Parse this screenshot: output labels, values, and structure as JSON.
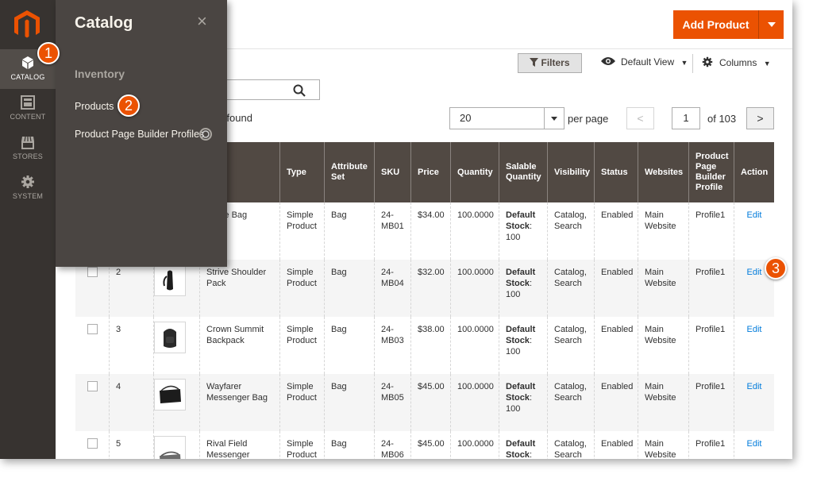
{
  "nav": {
    "items": [
      {
        "label": "CATALOG",
        "icon": "cube-icon"
      },
      {
        "label": "CONTENT",
        "icon": "layout-icon"
      },
      {
        "label": "STORES",
        "icon": "store-icon"
      },
      {
        "label": "SYSTEM",
        "icon": "gear-icon"
      }
    ]
  },
  "flyout": {
    "title": "Catalog",
    "close": "×",
    "section": "Inventory",
    "links": [
      "Products",
      "Product Page Builder Profiles"
    ]
  },
  "callouts": [
    "1",
    "2",
    "3"
  ],
  "header": {
    "add_product": "Add Product"
  },
  "toolbar": {
    "filters": "Filters",
    "default_view": "Default View",
    "columns": "Columns",
    "records_found": "cords found",
    "per_page_value": "20",
    "per_page_label": "per page",
    "page": "1",
    "of_pages": "of 103",
    "prev": "<",
    "next": ">"
  },
  "table": {
    "headers": [
      "",
      "",
      "",
      "e",
      "Type",
      "Attribute Set",
      "SKU",
      "Price",
      "Quantity",
      "Salable Quantity",
      "Visibility",
      "Status",
      "Websites",
      "Product Page Builder Profile",
      "Action"
    ],
    "rows": [
      {
        "id": "",
        "name": "Duffle Bag",
        "type": "Simple Product",
        "attr": "Bag",
        "sku": "24-MB01",
        "price": "$34.00",
        "qty": "100.0000",
        "salable_label": "Default Stock",
        "salable_value": ": 100",
        "visibility": "Catalog, Search",
        "status": "Enabled",
        "websites": "Main Website",
        "profile": "Profile1",
        "action": "Edit"
      },
      {
        "id": "2",
        "name": "Strive Shoulder Pack",
        "type": "Simple Product",
        "attr": "Bag",
        "sku": "24-MB04",
        "price": "$32.00",
        "qty": "100.0000",
        "salable_label": "Default Stock",
        "salable_value": ": 100",
        "visibility": "Catalog, Search",
        "status": "Enabled",
        "websites": "Main Website",
        "profile": "Profile1",
        "action": "Edit"
      },
      {
        "id": "3",
        "name": "Crown Summit Backpack",
        "type": "Simple Product",
        "attr": "Bag",
        "sku": "24-MB03",
        "price": "$38.00",
        "qty": "100.0000",
        "salable_label": "Default Stock",
        "salable_value": ": 100",
        "visibility": "Catalog, Search",
        "status": "Enabled",
        "websites": "Main Website",
        "profile": "Profile1",
        "action": "Edit"
      },
      {
        "id": "4",
        "name": "Wayfarer Messenger Bag",
        "type": "Simple Product",
        "attr": "Bag",
        "sku": "24-MB05",
        "price": "$45.00",
        "qty": "100.0000",
        "salable_label": "Default Stock",
        "salable_value": ": 100",
        "visibility": "Catalog, Search",
        "status": "Enabled",
        "websites": "Main Website",
        "profile": "Profile1",
        "action": "Edit"
      },
      {
        "id": "5",
        "name": "Rival Field Messenger",
        "type": "Simple Product",
        "attr": "Bag",
        "sku": "24-MB06",
        "price": "$45.00",
        "qty": "100.0000",
        "salable_label": "Default Stock",
        "salable_value": ":",
        "visibility": "Catalog, Search",
        "status": "Enabled",
        "websites": "Main Website",
        "profile": "Profile1",
        "action": "Edit"
      }
    ]
  },
  "colors": {
    "accent": "#eb5202",
    "nav_bg": "#373330",
    "flyout_bg": "#4a4542",
    "header_bg": "#514943",
    "link": "#007bdb"
  }
}
